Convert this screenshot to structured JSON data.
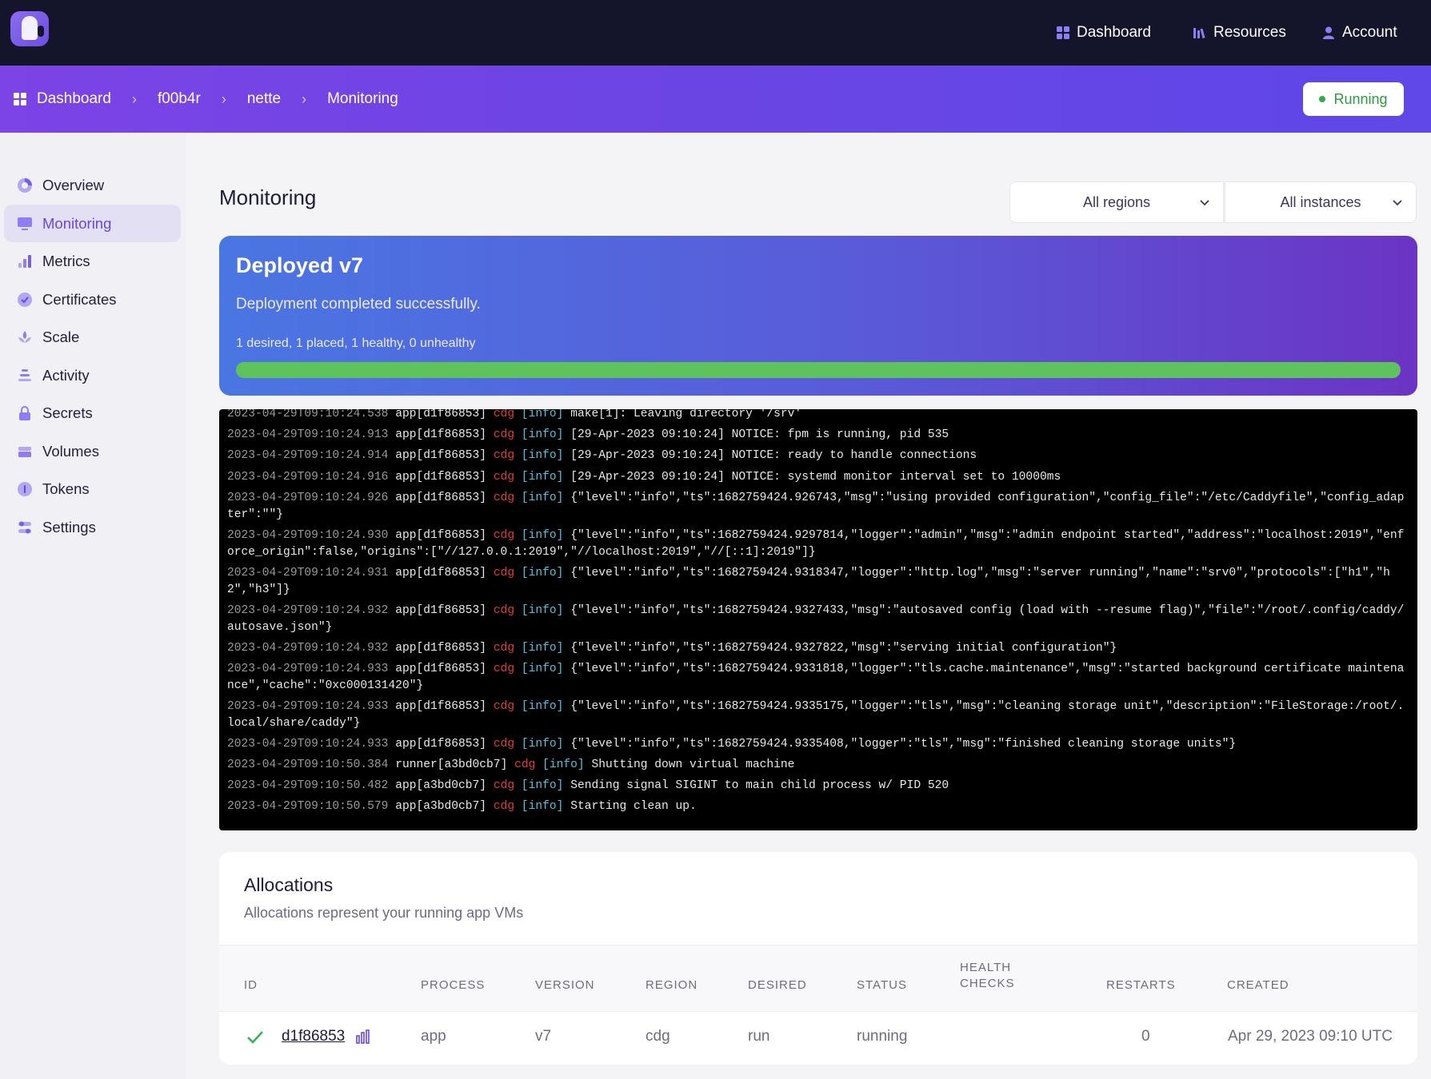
{
  "topnav": {
    "dashboard": "Dashboard",
    "resources": "Resources",
    "account": "Account"
  },
  "breadcrumb": [
    "Dashboard",
    "f00b4r",
    "nette",
    "Monitoring"
  ],
  "app_status": "Running",
  "sidebar": {
    "items": [
      {
        "label": "Overview",
        "icon": "overview-icon"
      },
      {
        "label": "Monitoring",
        "icon": "monitor-icon"
      },
      {
        "label": "Metrics",
        "icon": "metrics-icon"
      },
      {
        "label": "Certificates",
        "icon": "certificate-icon"
      },
      {
        "label": "Scale",
        "icon": "scale-icon"
      },
      {
        "label": "Activity",
        "icon": "activity-icon"
      },
      {
        "label": "Secrets",
        "icon": "lock-icon"
      },
      {
        "label": "Volumes",
        "icon": "volume-icon"
      },
      {
        "label": "Tokens",
        "icon": "token-icon"
      },
      {
        "label": "Settings",
        "icon": "settings-icon"
      }
    ],
    "active_index": 1
  },
  "main": {
    "title": "Monitoring",
    "region_select": "All regions",
    "instance_select": "All instances"
  },
  "deployment": {
    "title": "Deployed v7",
    "message": "Deployment completed successfully.",
    "counts": "1 desired, 1 placed, 1 healthy, 0 unhealthy",
    "progress_percent": 100
  },
  "logs": [
    {
      "ts": "2023-04-29T09:10:24.538",
      "src": "app[d1f86853]",
      "region": "cdg",
      "level": "[info]",
      "msg": "make[1]: Leaving directory '/srv'"
    },
    {
      "ts": "2023-04-29T09:10:24.913",
      "src": "app[d1f86853]",
      "region": "cdg",
      "level": "[info]",
      "msg": "[29-Apr-2023 09:10:24] NOTICE: fpm is running, pid 535"
    },
    {
      "ts": "2023-04-29T09:10:24.914",
      "src": "app[d1f86853]",
      "region": "cdg",
      "level": "[info]",
      "msg": "[29-Apr-2023 09:10:24] NOTICE: ready to handle connections"
    },
    {
      "ts": "2023-04-29T09:10:24.916",
      "src": "app[d1f86853]",
      "region": "cdg",
      "level": "[info]",
      "msg": "[29-Apr-2023 09:10:24] NOTICE: systemd monitor interval set to 10000ms"
    },
    {
      "ts": "2023-04-29T09:10:24.926",
      "src": "app[d1f86853]",
      "region": "cdg",
      "level": "[info]",
      "msg": "{\"level\":\"info\",\"ts\":1682759424.926743,\"msg\":\"using provided configuration\",\"config_file\":\"/etc/Caddyfile\",\"config_adapter\":\"\"}"
    },
    {
      "ts": "2023-04-29T09:10:24.930",
      "src": "app[d1f86853]",
      "region": "cdg",
      "level": "[info]",
      "msg": "{\"level\":\"info\",\"ts\":1682759424.9297814,\"logger\":\"admin\",\"msg\":\"admin endpoint started\",\"address\":\"localhost:2019\",\"enforce_origin\":false,\"origins\":[\"//127.0.0.1:2019\",\"//localhost:2019\",\"//[::1]:2019\"]}"
    },
    {
      "ts": "2023-04-29T09:10:24.931",
      "src": "app[d1f86853]",
      "region": "cdg",
      "level": "[info]",
      "msg": "{\"level\":\"info\",\"ts\":1682759424.9318347,\"logger\":\"http.log\",\"msg\":\"server running\",\"name\":\"srv0\",\"protocols\":[\"h1\",\"h2\",\"h3\"]}"
    },
    {
      "ts": "2023-04-29T09:10:24.932",
      "src": "app[d1f86853]",
      "region": "cdg",
      "level": "[info]",
      "msg": "{\"level\":\"info\",\"ts\":1682759424.9327433,\"msg\":\"autosaved config (load with --resume flag)\",\"file\":\"/root/.config/caddy/autosave.json\"}"
    },
    {
      "ts": "2023-04-29T09:10:24.932",
      "src": "app[d1f86853]",
      "region": "cdg",
      "level": "[info]",
      "msg": "{\"level\":\"info\",\"ts\":1682759424.9327822,\"msg\":\"serving initial configuration\"}"
    },
    {
      "ts": "2023-04-29T09:10:24.933",
      "src": "app[d1f86853]",
      "region": "cdg",
      "level": "[info]",
      "msg": "{\"level\":\"info\",\"ts\":1682759424.9331818,\"logger\":\"tls.cache.maintenance\",\"msg\":\"started background certificate maintenance\",\"cache\":\"0xc000131420\"}"
    },
    {
      "ts": "2023-04-29T09:10:24.933",
      "src": "app[d1f86853]",
      "region": "cdg",
      "level": "[info]",
      "msg": "{\"level\":\"info\",\"ts\":1682759424.9335175,\"logger\":\"tls\",\"msg\":\"cleaning storage unit\",\"description\":\"FileStorage:/root/.local/share/caddy\"}"
    },
    {
      "ts": "2023-04-29T09:10:24.933",
      "src": "app[d1f86853]",
      "region": "cdg",
      "level": "[info]",
      "msg": "{\"level\":\"info\",\"ts\":1682759424.9335408,\"logger\":\"tls\",\"msg\":\"finished cleaning storage units\"}"
    },
    {
      "ts": "2023-04-29T09:10:50.384",
      "src": "runner[a3bd0cb7]",
      "region": "cdg",
      "level": "[info]",
      "msg": "Shutting down virtual machine"
    },
    {
      "ts": "2023-04-29T09:10:50.482",
      "src": "app[a3bd0cb7]",
      "region": "cdg",
      "level": "[info]",
      "msg": "Sending signal SIGINT to main child process w/ PID 520"
    },
    {
      "ts": "2023-04-29T09:10:50.579",
      "src": "app[a3bd0cb7]",
      "region": "cdg",
      "level": "[info]",
      "msg": "Starting clean up."
    }
  ],
  "allocations": {
    "title": "Allocations",
    "description": "Allocations represent your running app VMs",
    "columns": [
      "ID",
      "PROCESS",
      "VERSION",
      "REGION",
      "DESIRED",
      "STATUS",
      "HEALTH CHECKS",
      "RESTARTS",
      "CREATED"
    ],
    "rows": [
      {
        "id": "d1f86853",
        "process": "app",
        "version": "v7",
        "region": "cdg",
        "desired": "run",
        "status": "running",
        "health_checks": "",
        "restarts": "0",
        "created": "Apr 29, 2023 09:10 UTC"
      }
    ]
  },
  "colors": {
    "accent": "#6a45e4",
    "topbar": "#14142b",
    "running": "#2a9b3f",
    "progress": "#5ec35a",
    "log_region": "#e23b3b",
    "log_level": "#4fc3e0"
  }
}
